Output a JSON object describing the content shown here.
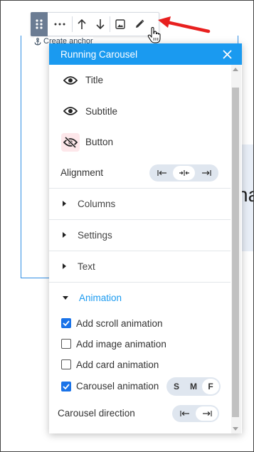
{
  "toolbar": {
    "drag_icon": "drag-grip-icon",
    "more_icon": "ellipsis-icon",
    "up_icon": "arrow-up-icon",
    "down_icon": "arrow-down-icon",
    "image_icon": "image-icon",
    "edit_icon": "pencil-icon"
  },
  "anchor": {
    "label": "Create anchor",
    "icon": "anchor-icon"
  },
  "canvas": {
    "partial_text": "na"
  },
  "panel": {
    "title": "Running Carousel",
    "close_icon": "close-icon",
    "visibility": [
      {
        "label": "Title",
        "icon": "eye-icon"
      },
      {
        "label": "Subtitle",
        "icon": "eye-icon"
      },
      {
        "label": "Button",
        "icon": "eye-off-icon"
      }
    ],
    "alignment": {
      "label": "Alignment",
      "options": [
        "align-left-icon",
        "align-center-icon",
        "align-right-icon"
      ],
      "selected": "center"
    },
    "sections": [
      {
        "label": "Columns",
        "expanded": false
      },
      {
        "label": "Settings",
        "expanded": false
      },
      {
        "label": "Text",
        "expanded": false
      },
      {
        "label": "Animation",
        "expanded": true
      }
    ],
    "animation": {
      "options": [
        {
          "label": "Add scroll animation",
          "checked": true
        },
        {
          "label": "Add image animation",
          "checked": false
        },
        {
          "label": "Add card animation",
          "checked": false
        }
      ],
      "carousel": {
        "label": "Carousel animation",
        "checked": true,
        "sizes": [
          "S",
          "M",
          "F"
        ],
        "selected_size": "F"
      },
      "direction": {
        "label": "Carousel direction",
        "options": [
          "direction-left-icon",
          "direction-right-icon"
        ],
        "selected": "right"
      }
    }
  },
  "colors": {
    "accent": "#1a9af0",
    "checkbox": "#1a73e8",
    "annotation_arrow": "#e8201f"
  }
}
